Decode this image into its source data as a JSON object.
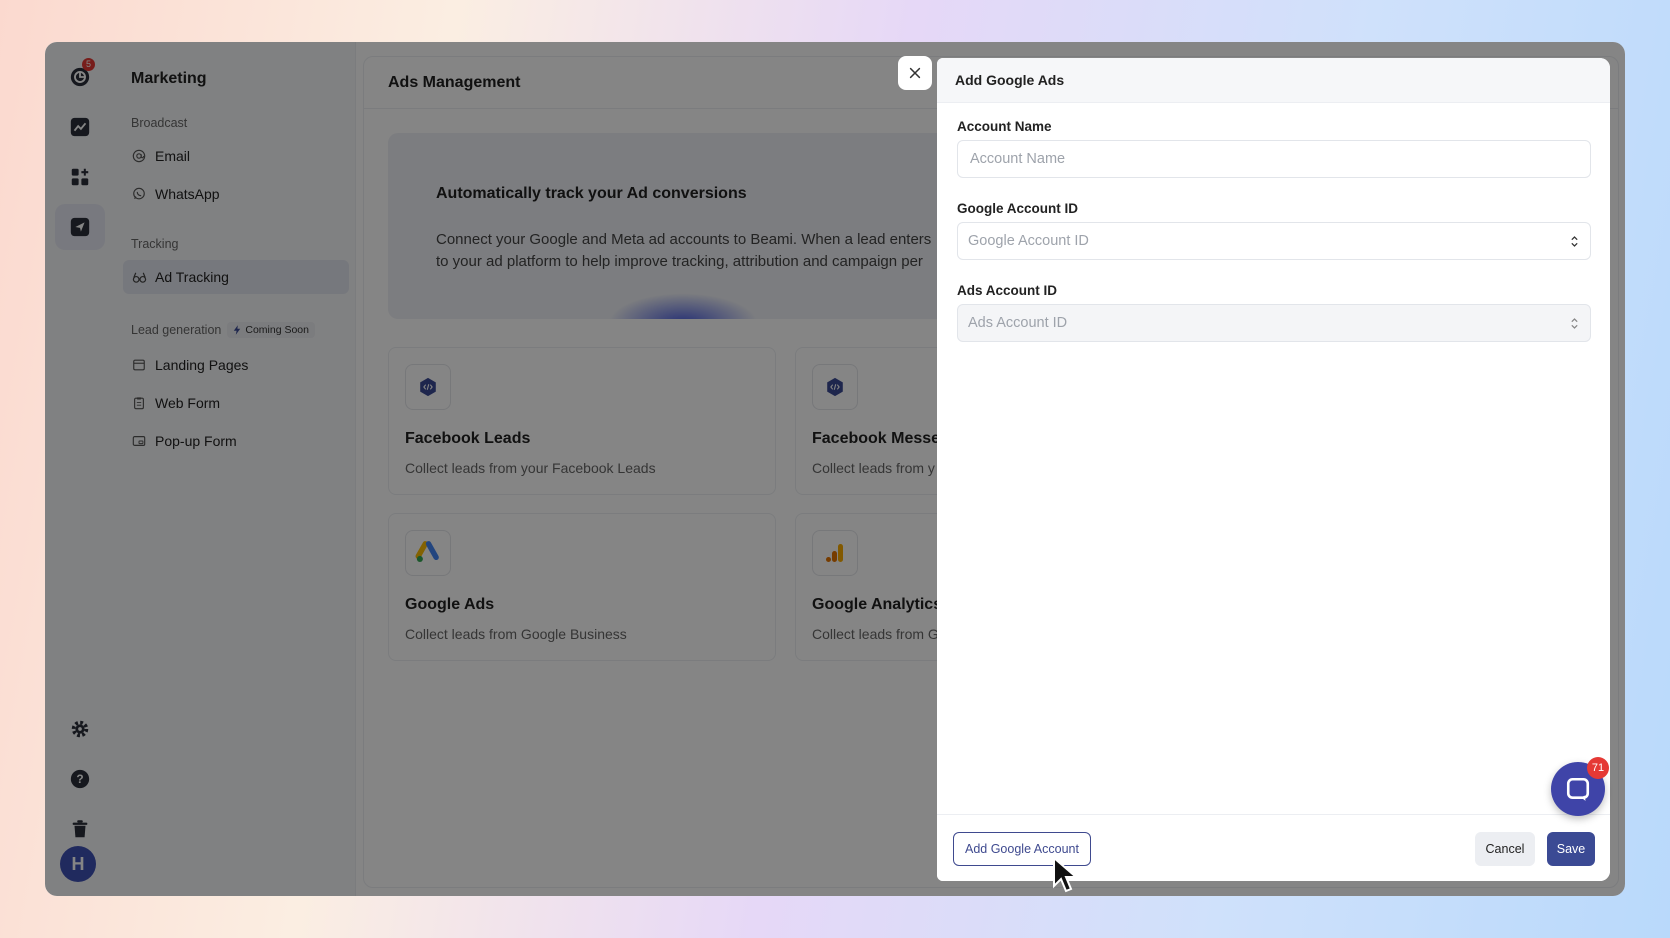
{
  "rail": {
    "notification_count": "5",
    "avatar_initial": "H"
  },
  "sidebar": {
    "title": "Marketing",
    "groups": {
      "broadcast": "Broadcast",
      "tracking": "Tracking",
      "lead_generation": "Lead generation",
      "coming_soon": "Coming Soon"
    },
    "items": {
      "email": "Email",
      "whatsapp": "WhatsApp",
      "ad_tracking": "Ad Tracking",
      "landing_pages": "Landing Pages",
      "web_form": "Web Form",
      "popup_form": "Pop-up Form"
    }
  },
  "main": {
    "title": "Ads Management",
    "hero": {
      "title": "Automatically track your Ad conversions",
      "line1": "Connect your Google and Meta ad accounts to Beami. When a lead enters",
      "line2": "to your ad platform to help improve tracking, attribution and campaign per"
    },
    "cards": [
      {
        "title": "Facebook Leads",
        "desc": "Collect leads from your Facebook Leads"
      },
      {
        "title": "Facebook Messe",
        "desc": "Collect leads from y"
      },
      {
        "title": "Google Ads",
        "desc": "Collect leads from Google Business"
      },
      {
        "title": "Google Analytics",
        "desc": "Collect leads from G"
      }
    ]
  },
  "drawer": {
    "title": "Add Google Ads",
    "fields": {
      "account_name_label": "Account Name",
      "account_name_placeholder": "Account Name",
      "google_account_id_label": "Google Account ID",
      "google_account_id_placeholder": "Google Account ID",
      "ads_account_id_label": "Ads Account ID",
      "ads_account_id_placeholder": "Ads Account ID"
    },
    "footer": {
      "add_account_label": "Add Google Account",
      "cancel_label": "Cancel",
      "save_label": "Save"
    }
  },
  "chat": {
    "unread_count": "71"
  },
  "colors": {
    "accent": "#3b4a94",
    "badge": "#e53935",
    "chat": "#3f44a8"
  }
}
